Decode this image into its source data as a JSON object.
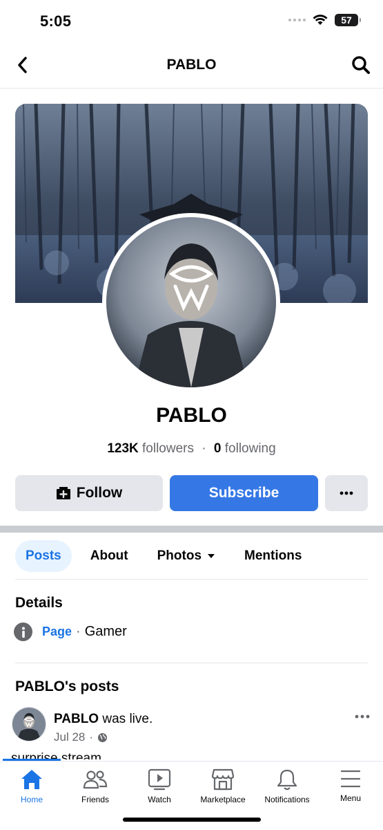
{
  "status_bar": {
    "time": "5:05",
    "battery": "57"
  },
  "header": {
    "title": "PABLO"
  },
  "profile": {
    "name": "PABLO",
    "followers_count": "123K",
    "followers_label": "followers",
    "separator": "·",
    "following_count": "0",
    "following_label": "following"
  },
  "actions": {
    "follow": "Follow",
    "subscribe": "Subscribe"
  },
  "tabs": [
    {
      "label": "Posts",
      "active": true
    },
    {
      "label": "About"
    },
    {
      "label": "Photos"
    },
    {
      "label": "Mentions"
    }
  ],
  "details": {
    "title": "Details",
    "link": "Page",
    "separator": "·",
    "category": "Gamer"
  },
  "posts_section": {
    "title": "PABLO's posts"
  },
  "post": {
    "author": "PABLO",
    "action": "was live.",
    "date": "Jul 28",
    "dot": "·",
    "text": "surprise stream"
  },
  "bottom_nav": [
    {
      "label": "Home",
      "icon": "home-icon",
      "active": true
    },
    {
      "label": "Friends",
      "icon": "friends-icon"
    },
    {
      "label": "Watch",
      "icon": "watch-icon"
    },
    {
      "label": "Marketplace",
      "icon": "marketplace-icon"
    },
    {
      "label": "Notifications",
      "icon": "bell-icon"
    },
    {
      "label": "Menu",
      "icon": "menu-icon"
    }
  ],
  "colors": {
    "accent": "#1b74e4",
    "subscribe": "#3578e5",
    "button_grey": "#e4e6eb"
  }
}
